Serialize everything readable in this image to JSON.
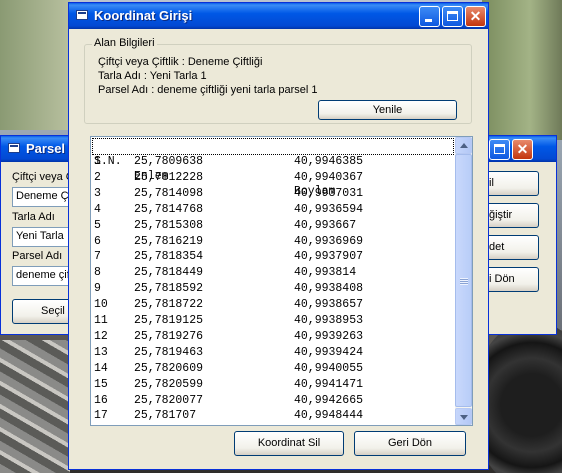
{
  "main_dialog": {
    "title": "Koordinat Girişi",
    "group_title": "Alan Bilgileri",
    "farmer_line": "Çiftçi veya Çiftlik : Deneme Çiftliği",
    "field_line": "Tarla Adı : Yeni Tarla 1",
    "parcel_line": "Parsel Adı : deneme çiftliği yeni tarla parsel 1",
    "refresh_label": "Yenile",
    "delete_coord_label": "Koordinat Sil",
    "back_label": "Geri Dön",
    "list": {
      "headers": [
        "S.N.",
        "Enlem",
        "Boylam"
      ],
      "rows": [
        [
          "1",
          "25,7809638",
          "40,9946385"
        ],
        [
          "2",
          "25,7812228",
          "40,9940367"
        ],
        [
          "3",
          "25,7814098",
          "40,9937031"
        ],
        [
          "4",
          "25,7814768",
          "40,9936594"
        ],
        [
          "5",
          "25,7815308",
          "40,993667"
        ],
        [
          "6",
          "25,7816219",
          "40,9936969"
        ],
        [
          "7",
          "25,7818354",
          "40,9937907"
        ],
        [
          "8",
          "25,7818449",
          "40,993814"
        ],
        [
          "9",
          "25,7818592",
          "40,9938408"
        ],
        [
          "10",
          "25,7818722",
          "40,9938657"
        ],
        [
          "11",
          "25,7819125",
          "40,9938953"
        ],
        [
          "12",
          "25,7819276",
          "40,9939263"
        ],
        [
          "13",
          "25,7819463",
          "40,9939424"
        ],
        [
          "14",
          "25,7820609",
          "40,9940055"
        ],
        [
          "15",
          "25,7820599",
          "40,9941471"
        ],
        [
          "16",
          "25,7820077",
          "40,9942665"
        ],
        [
          "17",
          "25,781707",
          "40,9948444"
        ]
      ]
    }
  },
  "parsel_window": {
    "title": "Parsel",
    "farmer_label": "Çiftçi veya Ç",
    "farmer_value": "Deneme Çi",
    "field_label": "Tarla Adı",
    "field_value": "Yeni Tarla",
    "parcel_label": "Parsel Adı",
    "parcel_value": "deneme çif",
    "select_label": "Seçil"
  },
  "right_window": {
    "buttons": [
      "il",
      "ğiştir",
      "det",
      "i Dön"
    ]
  },
  "colors": {
    "titlebar": "#0058e6",
    "window_bg": "#ece9d8",
    "close_button": "#c2350e"
  }
}
